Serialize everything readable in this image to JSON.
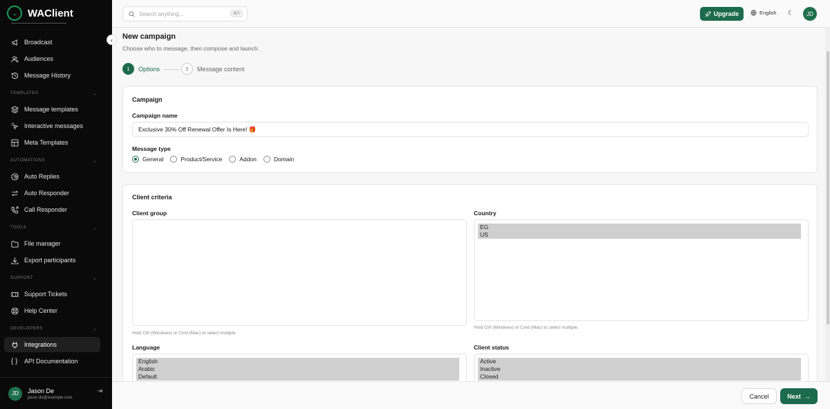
{
  "brand": {
    "name": "WAClient",
    "logo_text": "..."
  },
  "sidebar": {
    "items_top": [
      {
        "label": "Broadcast",
        "icon": "megaphone-icon"
      },
      {
        "label": "Audiences",
        "icon": "users-icon"
      },
      {
        "label": "Message History",
        "icon": "history-icon"
      }
    ],
    "sections": [
      {
        "title": "TEMPLATES",
        "items": [
          {
            "label": "Message templates",
            "icon": "layers-icon"
          },
          {
            "label": "Interactive messages",
            "icon": "cursor-click-icon"
          },
          {
            "label": "Meta Templates",
            "icon": "layout-icon"
          }
        ]
      },
      {
        "title": "AUTOMATIONS",
        "items": [
          {
            "label": "Auto Replies",
            "icon": "reply-icon"
          },
          {
            "label": "Auto Responder",
            "icon": "repeat-icon"
          },
          {
            "label": "Call Responder",
            "icon": "phone-forward-icon"
          }
        ]
      },
      {
        "title": "TOOLS",
        "items": [
          {
            "label": "File manager",
            "icon": "folder-icon"
          },
          {
            "label": "Export participants",
            "icon": "download-icon"
          }
        ]
      },
      {
        "title": "SUPPORT",
        "items": [
          {
            "label": "Support Tickets",
            "icon": "ticket-icon"
          },
          {
            "label": "Help Center",
            "icon": "help-circle-icon"
          }
        ]
      },
      {
        "title": "DEVELOPERS",
        "items": [
          {
            "label": "Integrations",
            "icon": "plug-icon",
            "active": true
          },
          {
            "label": "API Documentation",
            "icon": "braces-icon"
          }
        ]
      }
    ],
    "user": {
      "initials": "JD",
      "name": "Jason De",
      "email": "jason.de@example.com"
    }
  },
  "topbar": {
    "search_placeholder": "Search anything...",
    "search_shortcut": "⌘K",
    "upgrade_label": "Upgrade",
    "language": "English",
    "avatar_initials": "JD"
  },
  "page": {
    "title": "New campaign",
    "subtitle": "Choose who to message, then compose and launch.",
    "steps": [
      {
        "number": "1",
        "label": "Options",
        "active": true
      },
      {
        "number": "2",
        "label": "Message content",
        "active": false
      }
    ]
  },
  "campaign_card": {
    "title": "Campaign",
    "name_label": "Campaign name",
    "name_value": "Exclusive 30% Off Renewal Offer Is Here! 🎁",
    "type_label": "Message type",
    "types": [
      {
        "label": "General",
        "checked": true
      },
      {
        "label": "Product/Service",
        "checked": false
      },
      {
        "label": "Addon",
        "checked": false
      },
      {
        "label": "Domain",
        "checked": false
      }
    ]
  },
  "criteria_card": {
    "title": "Client criteria",
    "client_group_label": "Client group",
    "client_group_options": [],
    "country_label": "Country",
    "country_options": [
      "EG",
      "US"
    ],
    "multi_hint": "Hold Ctrl (Windows) or Cmd (Mac) to select multiple.",
    "language_label": "Language",
    "language_options": [
      "English",
      "Arabic",
      "Default"
    ],
    "status_label": "Client status",
    "status_options": [
      "Active",
      "Inactive",
      "Closed"
    ]
  },
  "footer": {
    "cancel_label": "Cancel",
    "next_label": "Next"
  }
}
